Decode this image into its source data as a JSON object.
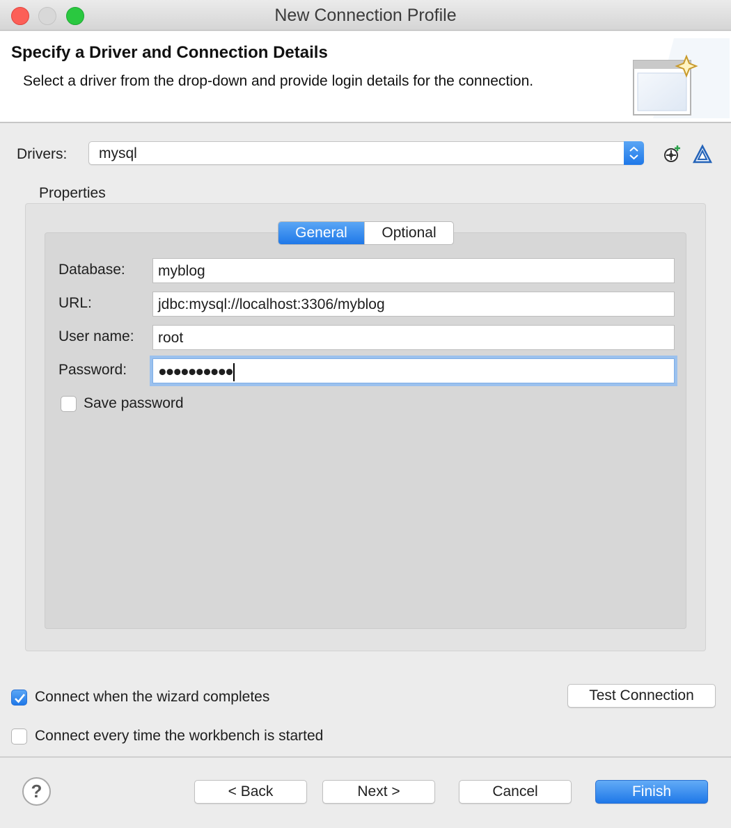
{
  "window": {
    "title": "New Connection Profile"
  },
  "header": {
    "title": "Specify a Driver and Connection Details",
    "subtitle": "Select a driver from the drop-down and provide login details for the connection."
  },
  "drivers": {
    "label": "Drivers:",
    "selected": "mysql"
  },
  "properties": {
    "label": "Properties",
    "tabs": [
      "General",
      "Optional"
    ],
    "active_tab": "General",
    "fields": {
      "database": {
        "label": "Database:",
        "value": "myblog"
      },
      "url": {
        "label": "URL:",
        "value": "jdbc:mysql://localhost:3306/myblog"
      },
      "username": {
        "label": "User name:",
        "value": "root"
      },
      "password": {
        "label": "Password:",
        "value": "●●●●●●●●●●"
      }
    },
    "save_password": {
      "label": "Save password",
      "checked": false
    }
  },
  "options": {
    "connect_on_complete": {
      "label": "Connect when the wizard completes",
      "checked": true
    },
    "connect_on_start": {
      "label": "Connect every time the workbench is started",
      "checked": false
    },
    "test_connection": "Test Connection"
  },
  "footer": {
    "help": "?",
    "back": "< Back",
    "next": "Next >",
    "cancel": "Cancel",
    "finish": "Finish"
  },
  "colors": {
    "accent": "#1f78e8",
    "close": "#fc5f57",
    "maximize": "#2ac840"
  }
}
